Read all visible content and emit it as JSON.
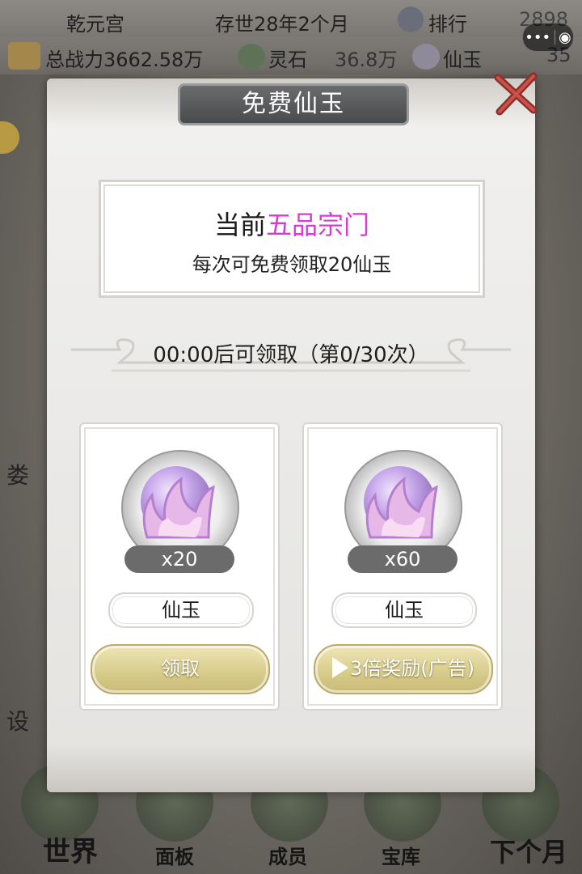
{
  "header": {
    "sect_name": "乾元宫",
    "era": "存世28年2个月",
    "ranking_label": "排行",
    "ranking_value": "2898",
    "total_power": "总战力3662.58万",
    "spirit_stone_label": "灵石",
    "spirit_stone_value": "36.8万",
    "jade_label": "仙玉",
    "jade_value": "35"
  },
  "capsule": {
    "more_icon": "•••",
    "close_icon": "◉"
  },
  "background": {
    "side_text_1": "娄",
    "side_text_2": "设"
  },
  "bottom_nav": {
    "items": [
      {
        "label": "世界"
      },
      {
        "label": "面板"
      },
      {
        "label": "成员"
      },
      {
        "label": "宝库"
      },
      {
        "label": "下个月"
      }
    ]
  },
  "modal": {
    "title": "免费仙玉",
    "info_prefix": "当前",
    "info_highlight": "五品宗门",
    "info_line2": "每次可免费领取20仙玉",
    "timer_text": "00:00后可领取（第0/30次）",
    "cards": [
      {
        "qty": "x20",
        "name": "仙玉",
        "button": "领取"
      },
      {
        "qty": "x60",
        "name": "仙玉",
        "button": "3倍奖励(广告)"
      }
    ]
  },
  "colors": {
    "highlight": "#d63bd6",
    "button_gold": "#d9cd8d",
    "orb": "#c9a9ec"
  }
}
